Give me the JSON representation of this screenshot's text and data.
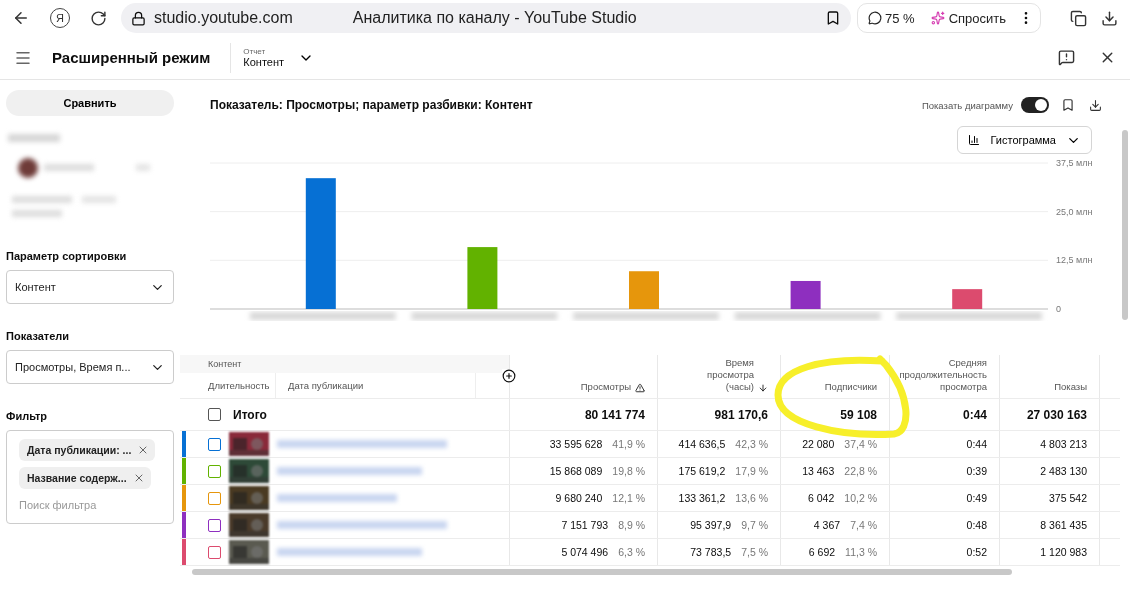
{
  "browser": {
    "logo": "Я",
    "address": "studio.youtube.com",
    "page_title": "Аналитика по каналу - YouTube Studio",
    "zoom": "75 %",
    "ask_button": "Спросить"
  },
  "header": {
    "title": "Расширенный режим",
    "report_label": "Отчет",
    "report_value": "Контент"
  },
  "sidebar": {
    "compare_button": "Сравнить",
    "sort": {
      "label": "Параметр сортировки",
      "value": "Контент"
    },
    "metrics": {
      "label": "Показатели",
      "value": "Просмотры, Время п..."
    },
    "filter": {
      "label": "Фильтр",
      "chips": [
        "Дата публикации: ...",
        "Название содерж..."
      ],
      "placeholder": "Поиск фильтра"
    }
  },
  "main": {
    "title": "Показатель: Просмотры; параметр разбивки: Контент",
    "chart_toggle": {
      "label": "Показать диаграмму",
      "on": true
    },
    "chart_type": "Гистограмма",
    "chart_data": {
      "type": "bar",
      "values": [
        33.6,
        15.9,
        9.7,
        7.2,
        5.1
      ],
      "ylim": [
        0,
        37.5
      ],
      "yticks": [
        {
          "value": 0,
          "label": "0"
        },
        {
          "value": 12.5,
          "label": "12,5 млн"
        },
        {
          "value": 25,
          "label": "25,0 млн"
        },
        {
          "value": 37.5,
          "label": "37,5 млн"
        }
      ]
    }
  },
  "table": {
    "header_group": "Контент",
    "sub_columns": [
      "Длительность",
      "Дата публикации"
    ],
    "columns": [
      {
        "label": "Просмотры",
        "kind": "warning"
      },
      {
        "label": "Время просмотра (часы)",
        "kind": "sorted"
      },
      {
        "label": "Подписчики",
        "kind": "plain"
      },
      {
        "label": "Средняя продолжительность просмотра",
        "kind": "plain"
      },
      {
        "label": "Показы",
        "kind": "plain"
      }
    ],
    "total": {
      "label": "Итого",
      "checked": false,
      "cells": [
        "80 141 774",
        "981 170,6",
        "59 108",
        "0:44",
        "27 030 163"
      ]
    },
    "rows": [
      {
        "color": "#0670d4",
        "checked": false,
        "cells": [
          {
            "value": "33 595 628",
            "share": "41,9 %"
          },
          {
            "value": "414 636,5",
            "share": "42,3 %"
          },
          {
            "value": "22 080",
            "share": "37,4 %"
          },
          {
            "value": "0:44"
          },
          {
            "value": "4 803 213"
          }
        ]
      },
      {
        "color": "#62b200",
        "checked": false,
        "cells": [
          {
            "value": "15 868 089",
            "share": "19,8 %"
          },
          {
            "value": "175 619,2",
            "share": "17,9 %"
          },
          {
            "value": "13 463",
            "share": "22,8 %"
          },
          {
            "value": "0:39"
          },
          {
            "value": "2 483 130"
          }
        ]
      },
      {
        "color": "#e6960c",
        "checked": false,
        "cells": [
          {
            "value": "9 680 240",
            "share": "12,1 %"
          },
          {
            "value": "133 361,2",
            "share": "13,6 %"
          },
          {
            "value": "6 042",
            "share": "10,2 %"
          },
          {
            "value": "0:49"
          },
          {
            "value": "375 542"
          }
        ]
      },
      {
        "color": "#8e2fbf",
        "checked": false,
        "cells": [
          {
            "value": "7 151 793",
            "share": "8,9 %"
          },
          {
            "value": "95 397,9",
            "share": "9,7 %"
          },
          {
            "value": "4 367",
            "share": "7,4 %"
          },
          {
            "value": "0:48"
          },
          {
            "value": "8 361 435"
          }
        ]
      },
      {
        "color": "#dc4b6e",
        "checked": false,
        "cells": [
          {
            "value": "5 074 496",
            "share": "6,3 %"
          },
          {
            "value": "73 783,5",
            "share": "7,5 %"
          },
          {
            "value": "6 692",
            "share": "11,3 %"
          },
          {
            "value": "0:52"
          },
          {
            "value": "1 120 983"
          }
        ]
      }
    ]
  }
}
